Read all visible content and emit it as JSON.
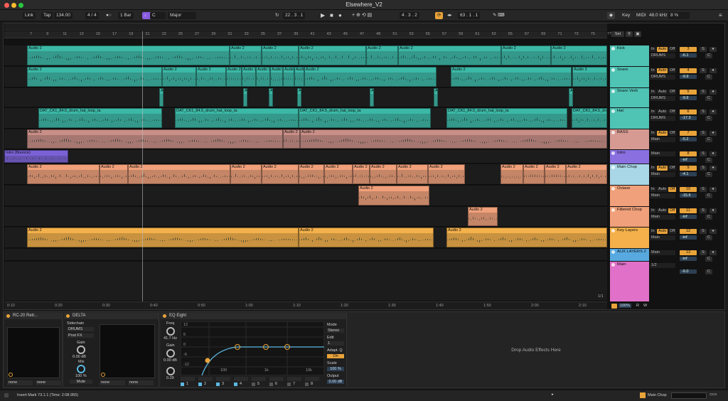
{
  "window": {
    "title": "Elsewhere_V2"
  },
  "control_bar": {
    "link": "Link",
    "tap": "Tap",
    "tempo": "134.00",
    "signature": "4 / 4",
    "quantize": "1 Bar",
    "key_root": "C",
    "scale": "Major",
    "position": "22 .  3 .  1",
    "loop_start": "4 .  3 .  2",
    "loop_length": "63 .  1 .  1",
    "key_label": "Key",
    "midi_label": "MIDI",
    "sample_rate": "48.0 kHz",
    "cpu": "8 %"
  },
  "ruler": {
    "bars": [
      "7",
      "9",
      "11",
      "13",
      "15",
      "17",
      "19",
      "21",
      "23",
      "25",
      "27",
      "29",
      "31",
      "33",
      "35",
      "37",
      "39",
      "41",
      "43",
      "45",
      "47",
      "49",
      "51",
      "53",
      "55",
      "57",
      "59",
      "61",
      "63",
      "65",
      "67",
      "69",
      "71",
      "73",
      "75",
      "77"
    ],
    "times": [
      "0:10",
      "0:20",
      "0:30",
      "0:40",
      "0:50",
      "1:00",
      "1:10",
      "1:20",
      "1:30",
      "1:40",
      "1:50",
      "2:00",
      "2:10"
    ]
  },
  "session": {
    "set_label": "Set",
    "page": "1/1",
    "zoom": "100%",
    "r_label": "R",
    "w_label": "W"
  },
  "tracks": [
    {
      "name": "Kick",
      "color": "#4fc3b4",
      "clip_color": "#3bb8a6",
      "input": "DRUMS",
      "num": "3",
      "vol": "-6.1",
      "auto": true
    },
    {
      "name": "Snare",
      "color": "#4fc3b4",
      "clip_color": "#3bb8a6",
      "input": "DRUMS",
      "num": "4",
      "vol": "-9.9",
      "auto": true
    },
    {
      "name": "Snare Verb",
      "color": "#4fc3b4",
      "clip_color": "#3bb8a6",
      "input": "DRUMS",
      "num": "5",
      "vol": "-9.9",
      "auto": false
    },
    {
      "name": "Hat",
      "color": "#4fc3b4",
      "clip_color": "#3bb8a6",
      "input": "DRUMS",
      "num": "6",
      "vol": "-17.3",
      "auto": false
    },
    {
      "name": "BASS",
      "color": "#d69a92",
      "clip_color": "#c98f87",
      "input": "Main",
      "num": "7",
      "vol": "-5.2",
      "auto": true
    },
    {
      "name": "Intro",
      "color": "#8a6fe0",
      "clip_color": "#7a62d6",
      "input": "Main",
      "num": "8",
      "vol": "-inf",
      "auto": false
    },
    {
      "name": "Main Chop",
      "color": "#a9d7e8",
      "clip_color": "#f0a07a",
      "input": "Main",
      "num": "9",
      "vol": "-4.1",
      "auto": true
    },
    {
      "name": "Octave",
      "color": "#f0a07a",
      "clip_color": "#f0a07a",
      "input": "Main",
      "num": "10",
      "vol": "-15.6",
      "auto": false
    },
    {
      "name": "Filtered Chop",
      "color": "#f0a07a",
      "clip_color": "#f0a07a",
      "input": "Main",
      "num": "11",
      "vol": "-inf",
      "auto": false
    },
    {
      "name": "Key Layers",
      "color": "#f4b04a",
      "clip_color": "#f4b04a",
      "input": "Main",
      "num": "12",
      "vol": "-inf",
      "auto": true
    },
    {
      "name": "AUX LAYERS 2",
      "color": "#57a9e0",
      "clip_color": "#57a9e0",
      "input": "Main",
      "num": "13",
      "vol": "-inf",
      "auto": false
    },
    {
      "name": "Main",
      "color": "#e070c8",
      "clip_color": "#e070c8",
      "input": "1/2",
      "num": "",
      "vol": "-6.0",
      "auto": false
    }
  ],
  "mixer_labels": {
    "in": "In",
    "auto": "Auto",
    "off": "Off",
    "s": "S",
    "c": "C"
  },
  "clip_names": {
    "audio2": "Audio 2",
    "hat_clip": "DAT_CK1_84.5_drum_hat_loop_ta",
    "intro_clip": "Intro (Bounce)"
  },
  "devices": {
    "d1": {
      "title": "RC-20 Retr...",
      "out1": "none",
      "out2": "none"
    },
    "d2": {
      "title": "DELTA",
      "sidechain": "Sidechain",
      "sc_input": "DRUMS",
      "sc_tap": "Post FX",
      "gain_label": "Gain",
      "gain_val": "0.00 dB",
      "mix_label": "Mix",
      "mix_val": "100 %",
      "mute": "Mute",
      "out1": "none",
      "out2": "none"
    },
    "d3": {
      "title": "EQ Eight",
      "freq_label": "Freq",
      "freq_val": "41.7 Hz",
      "gain_label": "Gain",
      "gain_val": "0.00 dB",
      "q_val": "0.29",
      "mode_label": "Mode",
      "mode_val": "Stereo",
      "edit_label": "Edit",
      "edit_val": "1",
      "adapt_label": "Adapt. Q",
      "adapt_val": "On",
      "scale_label": "Scale",
      "scale_val": "100 %",
      "output_label": "Output",
      "output_val": "0.00 dB",
      "db_ticks": [
        "12",
        "6",
        "0",
        "-6",
        "-12"
      ],
      "freq_ticks": [
        "100",
        "1k",
        "10k"
      ],
      "bands": [
        "1",
        "2",
        "3",
        "4",
        "5",
        "6",
        "7",
        "8"
      ]
    },
    "drop_hint": "Drop Audio Effects Here"
  },
  "status": {
    "message": "Insert Mark 73.1.1 (Time: 2:08.955)",
    "track": "Main Chop"
  }
}
